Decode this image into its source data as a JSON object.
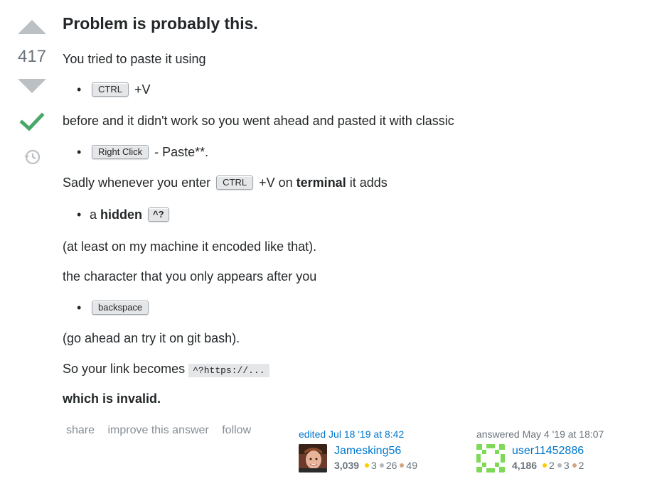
{
  "vote": {
    "count": "417"
  },
  "post": {
    "title": "Problem is probably this.",
    "p1": "You tried to paste it using",
    "li1_kbd": "CTRL",
    "li1_text": "+V",
    "p2": "before and it didn't work so you went ahead and pasted it with classic",
    "li2_kbd": "Right Click",
    "li2_text": "- Paste**.",
    "p3_a": "Sadly whenever you enter",
    "p3_kbd": "CTRL",
    "p3_b": "+V on",
    "p3_strong": "terminal",
    "p3_c": "it adds",
    "li3_a": "a",
    "li3_strong": "hidden",
    "li3_kbd": "^?",
    "p4": "(at least on my machine it encoded like that).",
    "p5": "the character that you only appears after you",
    "li4_kbd": "backspace",
    "p6": "(go ahead an try it on git bash).",
    "p7_a": "So your link becomes",
    "p7_code": "^?https://...",
    "p8": "which is invalid."
  },
  "menu": {
    "share": "share",
    "improve": "improve this answer",
    "follow": "follow"
  },
  "editor": {
    "action": "edited Jul 18 '19 at 8:42",
    "name": "Jamesking56",
    "rep": "3,039",
    "gold": "3",
    "silver": "26",
    "bronze": "49"
  },
  "author": {
    "action": "answered May 4 '19 at 18:07",
    "name": "user11452886",
    "rep": "4,186",
    "gold": "2",
    "silver": "3",
    "bronze": "2"
  },
  "colors": {
    "gold": "#ffcc01",
    "silver": "#b4b8bc",
    "bronze": "#d1a684",
    "accepted": "#48a868",
    "link": "#0077cc"
  }
}
